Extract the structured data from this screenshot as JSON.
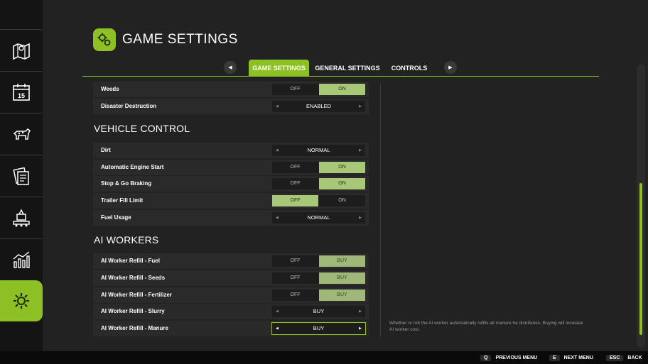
{
  "sidebar": {
    "items": [
      {
        "icon": "map-icon"
      },
      {
        "icon": "calendar-icon",
        "badge": "15"
      },
      {
        "icon": "animals-icon"
      },
      {
        "icon": "contracts-icon"
      },
      {
        "icon": "production-icon"
      },
      {
        "icon": "statistics-icon"
      },
      {
        "icon": "settings-icon",
        "active": true
      }
    ]
  },
  "header": {
    "title": "GAME SETTINGS",
    "tabs": [
      "GAME SETTINGS",
      "GENERAL SETTINGS",
      "CONTROLS"
    ],
    "prev_arrow": "◀",
    "next_arrow": "▶"
  },
  "settings": {
    "weeds": {
      "label": "Weeds",
      "off": "OFF",
      "on": "ON"
    },
    "disaster": {
      "label": "Disaster Destruction",
      "value": "ENABLED"
    },
    "vehicle_section": "VEHICLE CONTROL",
    "dirt": {
      "label": "Dirt",
      "value": "NORMAL"
    },
    "engine": {
      "label": "Automatic Engine Start",
      "off": "OFF",
      "on": "ON"
    },
    "braking": {
      "label": "Stop & Go Braking",
      "off": "OFF",
      "on": "ON"
    },
    "trailer": {
      "label": "Trailer Fill Limit",
      "off": "OFF",
      "on": "ON"
    },
    "fuel_usage": {
      "label": "Fuel Usage",
      "value": "NORMAL"
    },
    "ai_section": "AI WORKERS",
    "ai_fuel": {
      "label": "AI Worker Refill - Fuel",
      "off": "OFF",
      "buy": "BUY"
    },
    "ai_seeds": {
      "label": "AI Worker Refill - Seeds",
      "off": "OFF",
      "buy": "BUY"
    },
    "ai_fert": {
      "label": "AI Worker Refill - Fertilizer",
      "off": "OFF",
      "buy": "BUY"
    },
    "ai_slurry": {
      "label": "AI Worker Refill - Slurry",
      "value": "BUY"
    },
    "ai_manure": {
      "label": "AI Worker Refill - Manure",
      "value": "BUY"
    }
  },
  "help_text": "Whether or not the AI worker automatically refills all manure he distributes. Buying will increase AI worker cost.",
  "footer": {
    "prev": {
      "key": "Q",
      "label": "PREVIOUS MENU"
    },
    "next": {
      "key": "E",
      "label": "NEXT MENU"
    },
    "back": {
      "key": "ESC",
      "label": "BACK"
    }
  },
  "colors": {
    "accent": "#8cc025",
    "toggle_on": "#a8c878",
    "background": "#222222"
  }
}
